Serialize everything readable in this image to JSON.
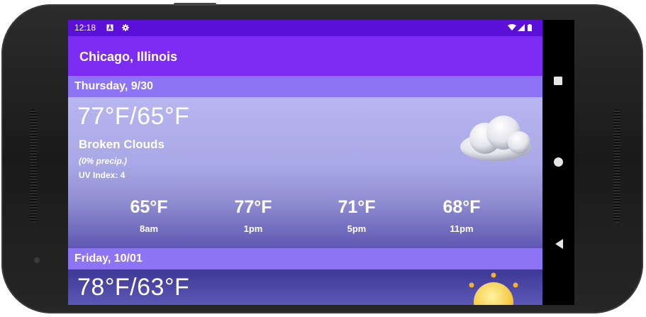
{
  "status_bar": {
    "time": "12:18",
    "icons": [
      "notification-a-icon",
      "settings-gear-icon",
      "wifi-icon",
      "signal-icon",
      "battery-icon"
    ]
  },
  "app_bar": {
    "title": "Chicago, Illinois"
  },
  "days": [
    {
      "date": "Thursday, 9/30",
      "temp_range": "77°F/65°F",
      "condition": "Broken Clouds",
      "precip": "(0% precip.)",
      "uv": "UV Index: 4",
      "icon": "cloud-icon",
      "hourly": [
        {
          "temp": "65°F",
          "time": "8am"
        },
        {
          "temp": "77°F",
          "time": "1pm"
        },
        {
          "temp": "71°F",
          "time": "5pm"
        },
        {
          "temp": "68°F",
          "time": "11pm"
        }
      ]
    },
    {
      "date": "Friday, 10/01",
      "temp_range": "78°F/63°F",
      "icon": "sun-icon"
    }
  ],
  "nav_bar": {
    "buttons": [
      "recents-square-icon",
      "home-circle-icon",
      "back-triangle-icon"
    ]
  },
  "colors": {
    "status_bar": "#5a10d6",
    "app_bar": "#7c2cf2",
    "day_header": "#8c74f4"
  }
}
